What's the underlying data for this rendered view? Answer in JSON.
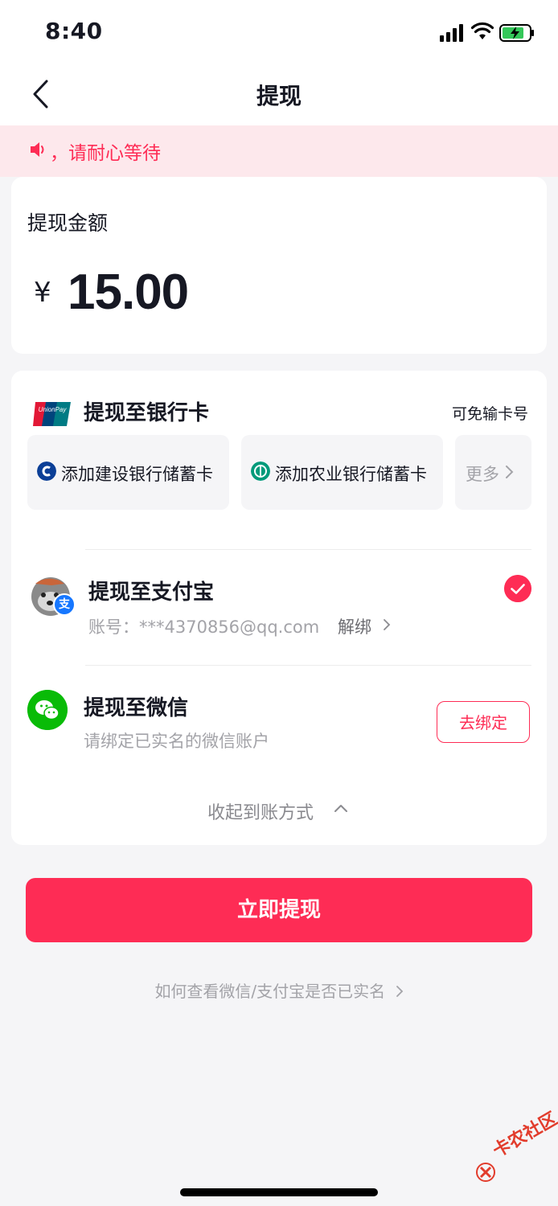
{
  "status": {
    "time": "8:40"
  },
  "nav": {
    "title": "提现"
  },
  "notice": {
    "text": "，请耐心等待"
  },
  "amount": {
    "label": "提现金额",
    "currency": "¥",
    "value": "15.00"
  },
  "bank": {
    "title": "提现至银行卡",
    "no_card_hint": "可免输卡号",
    "options": [
      {
        "label": "添加建设银行储蓄卡",
        "icon": "ccb-icon",
        "color": "#0b3f97"
      },
      {
        "label": "添加农业银行储蓄卡",
        "icon": "abc-icon",
        "color": "#009a7a"
      }
    ],
    "more_label": "更多"
  },
  "alipay": {
    "title": "提现至支付宝",
    "badge": "支",
    "account": "账号：***4370856@qq.com",
    "unbind_label": "解绑",
    "selected": true
  },
  "wechat": {
    "title": "提现至微信",
    "subtitle": "请绑定已实名的微信账户",
    "bind_label": "去绑定"
  },
  "collapse_label": "收起到账方式",
  "withdraw_button": "立即提现",
  "help_link": "如何查看微信/支付宝是否已实名",
  "watermark": "卡农社区",
  "colors": {
    "accent": "#fe2c55",
    "background": "#f5f5f7"
  }
}
